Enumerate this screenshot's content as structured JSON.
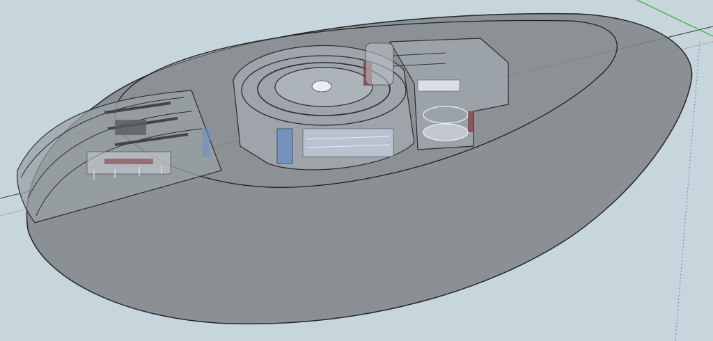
{
  "viewport": {
    "background_color": "#c6d6dc",
    "description_free": true
  },
  "axes": {
    "red_axis_color": "#c44a4a",
    "green_axis_color": "#2fae2f",
    "blue_axis_color": "#4a6cc4",
    "black_axis_color": "#1a1a1a"
  },
  "model": {
    "hull_fill": "#7f8487",
    "hull_stroke": "#232528",
    "inner_fill": "#8c9194",
    "glass_fill": "#b9c4cc",
    "accent_red": "#8a3a44",
    "accent_blue": "#6d8fc4",
    "window_white": "#e8eef4"
  }
}
